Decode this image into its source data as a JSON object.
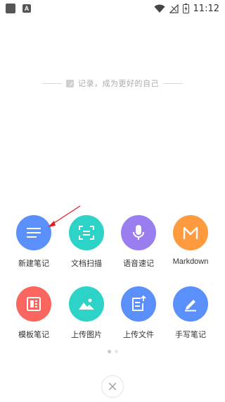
{
  "status_bar": {
    "time": "11:12",
    "app_indicator": "A",
    "icons": [
      "wifi-icon",
      "signal-icon",
      "battery-charging-icon"
    ]
  },
  "tagline": {
    "icon": "edit-note-icon",
    "text": "记录，成为更好的自己"
  },
  "grid": {
    "items": [
      {
        "label": "新建笔记",
        "icon": "new-note-icon",
        "color": "#5b8ff9"
      },
      {
        "label": "文档扫描",
        "icon": "scan-document-icon",
        "color": "#2ed3c7"
      },
      {
        "label": "语音速记",
        "icon": "microphone-icon",
        "color": "#9a7ef0"
      },
      {
        "label": "Markdown",
        "icon": "markdown-m-icon",
        "color": "#ff9a3e"
      },
      {
        "label": "模板笔记",
        "icon": "template-icon",
        "color": "#f9665f"
      },
      {
        "label": "上传图片",
        "icon": "image-icon",
        "color": "#2ed3c7"
      },
      {
        "label": "上传文件",
        "icon": "upload-file-icon",
        "color": "#5b8ff9"
      },
      {
        "label": "手写笔记",
        "icon": "handwrite-pen-icon",
        "color": "#5b8ff9"
      }
    ]
  },
  "pager": {
    "pages": 2,
    "current": 1
  },
  "close": {
    "icon": "close-icon"
  },
  "annotation": {
    "color": "#e02020"
  }
}
